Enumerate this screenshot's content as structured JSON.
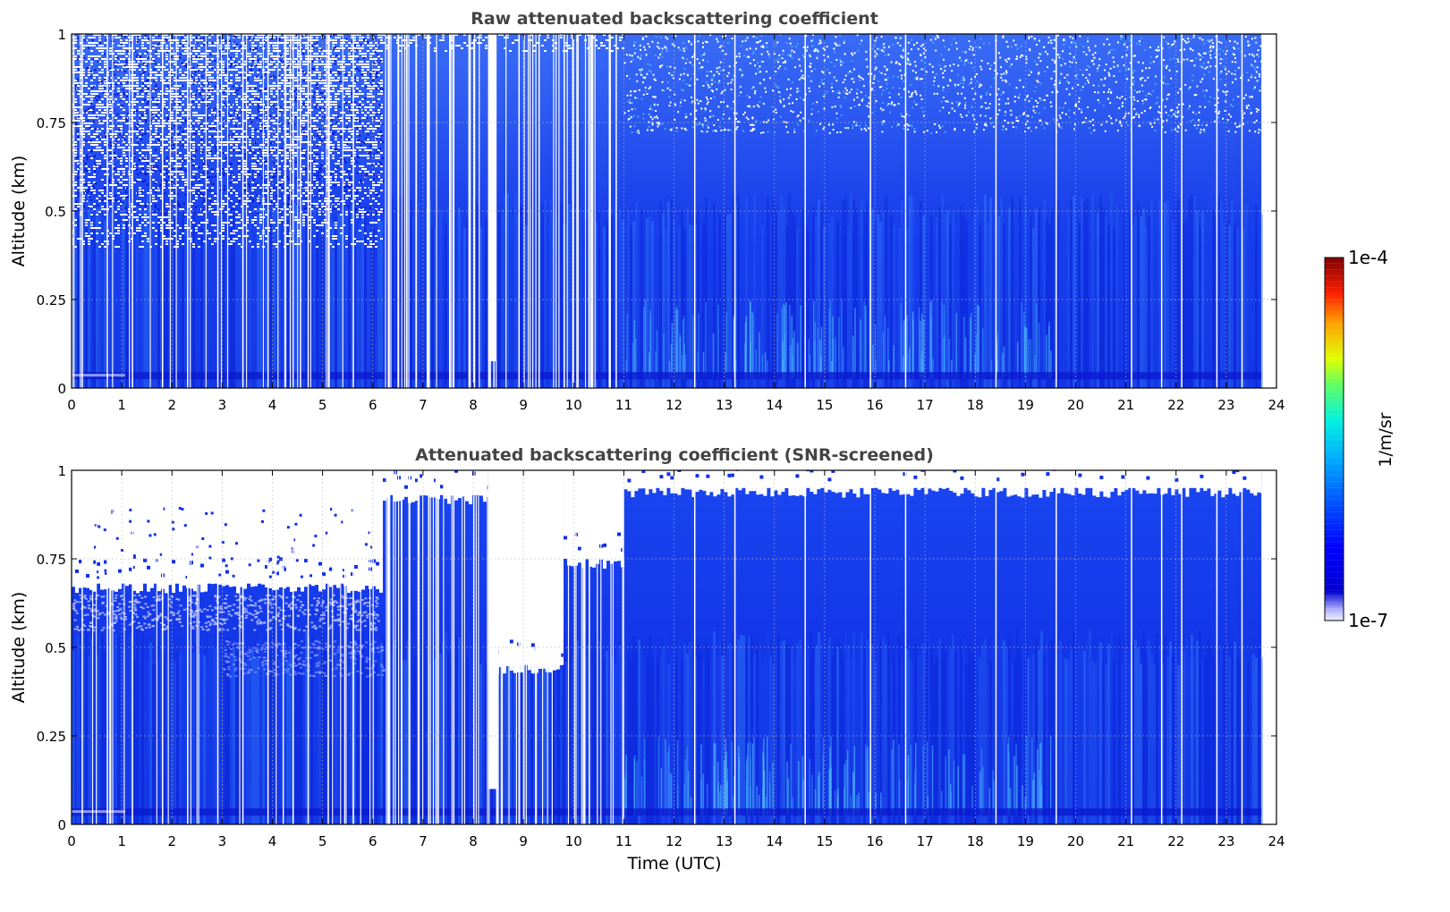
{
  "chart_data": [
    {
      "type": "heatmap",
      "title": "Raw attenuated backscattering coefficient",
      "ylabel": "Altitude (km)",
      "xlabel": "",
      "xlim": [
        0,
        24
      ],
      "ylim": [
        0,
        1
      ],
      "x_ticks": [
        "0",
        "1",
        "2",
        "3",
        "4",
        "5",
        "6",
        "7",
        "8",
        "9",
        "10",
        "11",
        "12",
        "13",
        "14",
        "15",
        "16",
        "17",
        "18",
        "19",
        "20",
        "21",
        "22",
        "23",
        "24"
      ],
      "y_ticks": [
        "0",
        "0.25",
        "0.5",
        "0.75",
        "1"
      ],
      "grid": true,
      "data_extent_hours": [
        0,
        23.7
      ],
      "description_bands": [
        {
          "x": [
            0,
            6.2
          ],
          "clear_above_km": 0.4,
          "level": "low"
        },
        {
          "x": [
            6.2,
            11
          ],
          "clear_above_km": 0.95,
          "level": "medium",
          "gap_hours": [
            8.3,
            8.5
          ]
        },
        {
          "x": [
            11,
            23.7
          ],
          "clear_above_km": 1.0,
          "level": "medium"
        }
      ],
      "blank_columns_hours": [
        0.2,
        0.7,
        1.2,
        1.8,
        2.3,
        2.9,
        3.4,
        3.9,
        4.4,
        4.7,
        5.1,
        5.6,
        6.3,
        6.5,
        7.1,
        7.6,
        8.0,
        8.4,
        8.9,
        9.3,
        9.8,
        10.3,
        10.7,
        12.4,
        13.2,
        14.6,
        15.9,
        16.6,
        18.4,
        19.6,
        21.1,
        21.7,
        22.1,
        22.8,
        23.3
      ]
    },
    {
      "type": "heatmap",
      "title": "Attenuated backscattering coefficient (SNR-screened)",
      "ylabel": "Altitude (km)",
      "xlabel": "Time (UTC)",
      "xlim": [
        0,
        24
      ],
      "ylim": [
        0,
        1
      ],
      "x_ticks": [
        "0",
        "1",
        "2",
        "3",
        "4",
        "5",
        "6",
        "7",
        "8",
        "9",
        "10",
        "11",
        "12",
        "13",
        "14",
        "15",
        "16",
        "17",
        "18",
        "19",
        "20",
        "21",
        "22",
        "23",
        "24"
      ],
      "y_ticks": [
        "0",
        "0.25",
        "0.5",
        "0.75",
        "1"
      ],
      "grid": true,
      "data_extent_hours": [
        0,
        23.7
      ],
      "screened_top_km": [
        {
          "x": [
            0,
            6.2
          ],
          "top_km": 0.68
        },
        {
          "x": [
            6.2,
            8.3
          ],
          "top_km": 0.93
        },
        {
          "x": [
            8.3,
            9.8
          ],
          "top_km": 0.45
        },
        {
          "x": [
            9.8,
            11
          ],
          "top_km": 0.75
        },
        {
          "x": [
            11,
            23.7
          ],
          "top_km": 0.95
        }
      ],
      "blank_columns_hours": [
        0.2,
        0.7,
        1.2,
        1.8,
        2.3,
        2.9,
        3.4,
        3.9,
        4.4,
        4.7,
        5.1,
        5.6,
        6.3,
        7.1,
        7.6,
        8.0,
        10.3,
        12.4,
        13.2,
        14.6,
        15.9,
        16.6,
        18.4,
        19.6,
        21.1,
        21.7,
        22.1,
        22.8,
        23.3
      ]
    }
  ],
  "colorbar": {
    "label": "1/m/sr",
    "max_label": "1e-4",
    "min_label": "1e-7",
    "colors": [
      "#f0f0ff",
      "#0000c8",
      "#0000ff",
      "#1a4dff",
      "#2e8bff",
      "#00e0e0",
      "#40ff80",
      "#e8ff00",
      "#ffa000",
      "#ff2000",
      "#800000"
    ]
  },
  "colors": {
    "background_blue": "#1030e8",
    "deep_blue": "#0a1ad0",
    "light_blue": "#2a7aff",
    "cyan": "#5ad0ff"
  }
}
